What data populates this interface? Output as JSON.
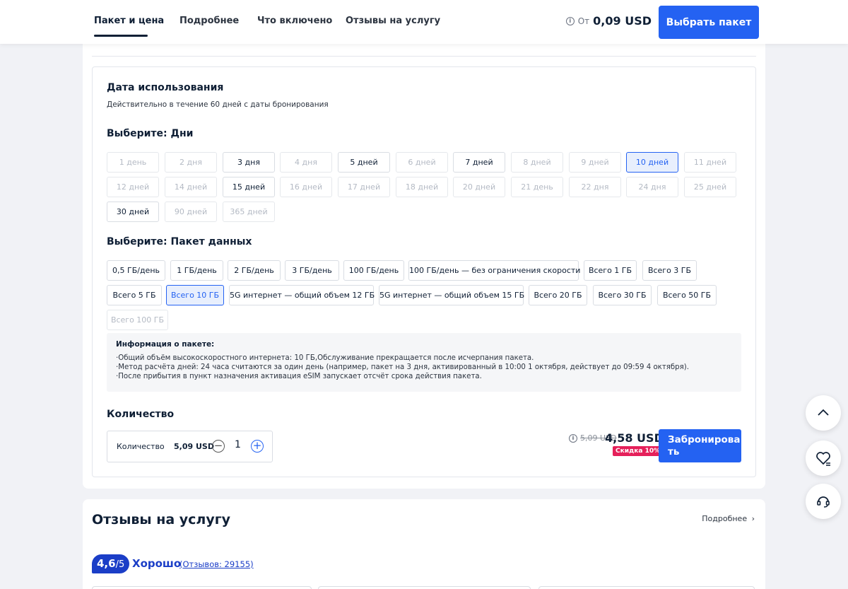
{
  "header": {
    "tabs": [
      {
        "label": "Пакет и цена"
      },
      {
        "label": "Подробнее"
      },
      {
        "label": "Что включено"
      },
      {
        "label": "Отзывы на услугу"
      }
    ],
    "price_prefix": "От",
    "price_value": "0,09 USD",
    "select_button": "Выбрать пакет"
  },
  "usage": {
    "title": "Дата использования",
    "subtitle": "Действительно в течение 60 дней с даты бронирования"
  },
  "days": {
    "title": "Выберите: Дни",
    "options": [
      {
        "label": "1 день",
        "state": "disabled"
      },
      {
        "label": "2 дня",
        "state": "disabled"
      },
      {
        "label": "3 дня",
        "state": "enabled"
      },
      {
        "label": "4 дня",
        "state": "disabled"
      },
      {
        "label": "5 дней",
        "state": "enabled"
      },
      {
        "label": "6 дней",
        "state": "disabled"
      },
      {
        "label": "7 дней",
        "state": "enabled"
      },
      {
        "label": "8 дней",
        "state": "disabled"
      },
      {
        "label": "9 дней",
        "state": "disabled"
      },
      {
        "label": "10 дней",
        "state": "selected"
      },
      {
        "label": "11 дней",
        "state": "disabled"
      },
      {
        "label": "12 дней",
        "state": "disabled"
      },
      {
        "label": "14 дней",
        "state": "disabled"
      },
      {
        "label": "15 дней",
        "state": "enabled"
      },
      {
        "label": "16 дней",
        "state": "disabled"
      },
      {
        "label": "17 дней",
        "state": "disabled"
      },
      {
        "label": "18 дней",
        "state": "disabled"
      },
      {
        "label": "20 дней",
        "state": "disabled"
      },
      {
        "label": "21 день",
        "state": "disabled"
      },
      {
        "label": "22 дня",
        "state": "disabled"
      },
      {
        "label": "24 дня",
        "state": "disabled"
      },
      {
        "label": "25 дней",
        "state": "disabled"
      },
      {
        "label": "30 дней",
        "state": "enabled"
      },
      {
        "label": "90 дней",
        "state": "disabled"
      },
      {
        "label": "365 дней",
        "state": "disabled"
      }
    ]
  },
  "packages": {
    "title": "Выберите: Пакет данных",
    "options": [
      {
        "label": "0,5 ГБ/день",
        "state": "enabled"
      },
      {
        "label": "1 ГБ/день",
        "state": "enabled"
      },
      {
        "label": "2 ГБ/день",
        "state": "enabled"
      },
      {
        "label": "3 ГБ/день",
        "state": "enabled"
      },
      {
        "label": "100 ГБ/день",
        "state": "enabled"
      },
      {
        "label": "100 ГБ/день — без ограничения скорости",
        "state": "enabled"
      },
      {
        "label": "Всего 1 ГБ",
        "state": "enabled"
      },
      {
        "label": "Всего 3 ГБ",
        "state": "enabled"
      },
      {
        "label": "Всего 5 ГБ",
        "state": "enabled"
      },
      {
        "label": "Всего 10 ГБ",
        "state": "selected"
      },
      {
        "label": "5G интернет — общий объем 12 ГБ",
        "state": "enabled"
      },
      {
        "label": "5G интернет — общий объем 15 ГБ",
        "state": "enabled"
      },
      {
        "label": "Всего 20 ГБ",
        "state": "enabled"
      },
      {
        "label": "Всего 30 ГБ",
        "state": "enabled"
      },
      {
        "label": "Всего 50 ГБ",
        "state": "enabled"
      },
      {
        "label": "Всего 100 ГБ",
        "state": "disabled"
      }
    ]
  },
  "package_info": {
    "title": "Информация о пакете:",
    "lines": [
      "·Общий объём высокоскоростного интернета: 10 ГБ,Обслуживание прекращается после исчерпания пакета.",
      "·Метод расчёта дней: 24 часа считаются за один день (например, пакет на 3 дня, активированный в 10:00 1 октября, действует до 09:59 4 октября).",
      "·После прибытия в пункт назначения активация eSIM запускает отсчёт срока действия пакета."
    ]
  },
  "quantity": {
    "title": "Количество",
    "label": "Количество",
    "unit_price": "5,09 USD",
    "value": "1"
  },
  "pricing": {
    "old_price": "5,09 USD",
    "new_price": "4,58 USD",
    "discount": "Скидка 10%",
    "book_button": "Забронировать"
  },
  "reviews": {
    "title": "Отзывы на услугу",
    "more_link": "Подробнее",
    "score": "4,6",
    "score_max": "/5",
    "verdict": "Хорошо",
    "count": "(Отзывов: 29155)"
  },
  "colors": {
    "accent": "#2462f2",
    "discount": "#e5205a",
    "rating": "#1b3ec7"
  },
  "floating": [
    "chevron-up-icon",
    "heart-icon",
    "headset-icon"
  ]
}
